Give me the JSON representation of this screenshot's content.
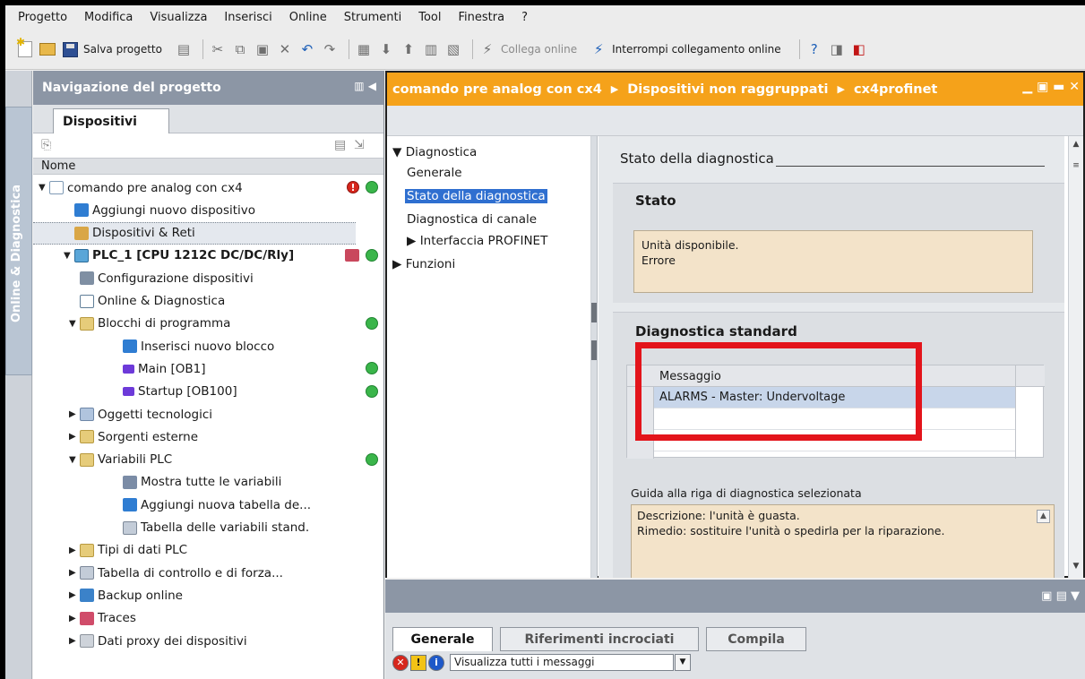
{
  "menu": [
    "Progetto",
    "Modifica",
    "Visualizza",
    "Inserisci",
    "Online",
    "Strumenti",
    "Tool",
    "Finestra",
    "?"
  ],
  "toolbar": {
    "save_label": "Salva progetto",
    "connect_label": "Collega online",
    "disconnect_label": "Interrompi collegamento online"
  },
  "side_tab": "Online & Diagnostica",
  "nav": {
    "title": "Navigazione del progetto",
    "tab": "Dispositivi",
    "column": "Nome",
    "items": [
      {
        "label": "comando pre analog con cx4",
        "expand": "▼",
        "indent": 0,
        "icon": "ico-proj",
        "status": "error-ok"
      },
      {
        "label": "Aggiungi nuovo dispositivo",
        "expand": "",
        "indent": 1,
        "icon": "ico-add"
      },
      {
        "label": "Dispositivi & Reti",
        "expand": "",
        "indent": 1,
        "icon": "ico-net",
        "selected": true
      },
      {
        "label": "PLC_1 [CPU 1212C DC/DC/Rly]",
        "expand": "▼",
        "indent": 1,
        "icon": "ico-plc",
        "status": "plc-ok",
        "bold": true
      },
      {
        "label": "Configurazione dispositivi",
        "expand": "",
        "indent": 2,
        "icon": "ico-cfg"
      },
      {
        "label": "Online & Diagnostica",
        "expand": "",
        "indent": 2,
        "icon": "ico-diag"
      },
      {
        "label": "Blocchi di programma",
        "expand": "▼",
        "indent": 2,
        "icon": "ico-fold",
        "status": "ok"
      },
      {
        "label": "Inserisci nuovo blocco",
        "expand": "",
        "indent": 3,
        "icon": "ico-add"
      },
      {
        "label": "Main [OB1]",
        "expand": "",
        "indent": 3,
        "icon": "ico-ob",
        "status": "ok"
      },
      {
        "label": "Startup [OB100]",
        "expand": "",
        "indent": 3,
        "icon": "ico-ob",
        "status": "ok"
      },
      {
        "label": "Oggetti tecnologici",
        "expand": "▶",
        "indent": 2,
        "icon": "ico-tech"
      },
      {
        "label": "Sorgenti esterne",
        "expand": "▶",
        "indent": 2,
        "icon": "ico-fold"
      },
      {
        "label": "Variabili PLC",
        "expand": "▼",
        "indent": 2,
        "icon": "ico-fold",
        "status": "ok"
      },
      {
        "label": "Mostra tutte le variabili",
        "expand": "",
        "indent": 3,
        "icon": "ico-var"
      },
      {
        "label": "Aggiungi nuova tabella de...",
        "expand": "",
        "indent": 3,
        "icon": "ico-add"
      },
      {
        "label": "Tabella delle variabili stand.",
        "expand": "",
        "indent": 3,
        "icon": "ico-tbl"
      },
      {
        "label": "Tipi di dati PLC",
        "expand": "▶",
        "indent": 2,
        "icon": "ico-fold"
      },
      {
        "label": "Tabella di controllo e di forza...",
        "expand": "▶",
        "indent": 2,
        "icon": "ico-tbl"
      },
      {
        "label": "Backup online",
        "expand": "▶",
        "indent": 2,
        "icon": "ico-bk"
      },
      {
        "label": "Traces",
        "expand": "▶",
        "indent": 2,
        "icon": "ico-trace"
      },
      {
        "label": "Dati proxy dei dispositivi",
        "expand": "▶",
        "indent": 2,
        "icon": "ico-proxy"
      }
    ]
  },
  "editor": {
    "breadcrumb": [
      "comando pre analog con cx4",
      "Dispositivi non raggruppati",
      "cx4profinet"
    ],
    "tree": {
      "diagnostica": "Diagnostica",
      "generale": "Generale",
      "stato": "Stato della diagnostica",
      "canale": "Diagnostica di canale",
      "profinet": "Interfaccia PROFINET",
      "funzioni": "Funzioni"
    },
    "section_title": "Stato della diagnostica",
    "stato": {
      "heading": "Stato",
      "line1": "Unità disponibile.",
      "line2": "Errore"
    },
    "standard": {
      "heading": "Diagnostica standard",
      "column": "Messaggio",
      "rows": [
        "ALARMS - Master: Undervoltage"
      ]
    },
    "guide": {
      "label": "Guida alla riga di diagnostica selezionata",
      "line1": "Descrizione: l'unità è guasta.",
      "line2": "Rimedio: sostituire l'unità o spedirla per la riparazione."
    }
  },
  "inspector": {
    "tabs": [
      "Generale",
      "Riferimenti incrociati",
      "Compila"
    ],
    "filter": "Visualizza tutti i messaggi"
  }
}
